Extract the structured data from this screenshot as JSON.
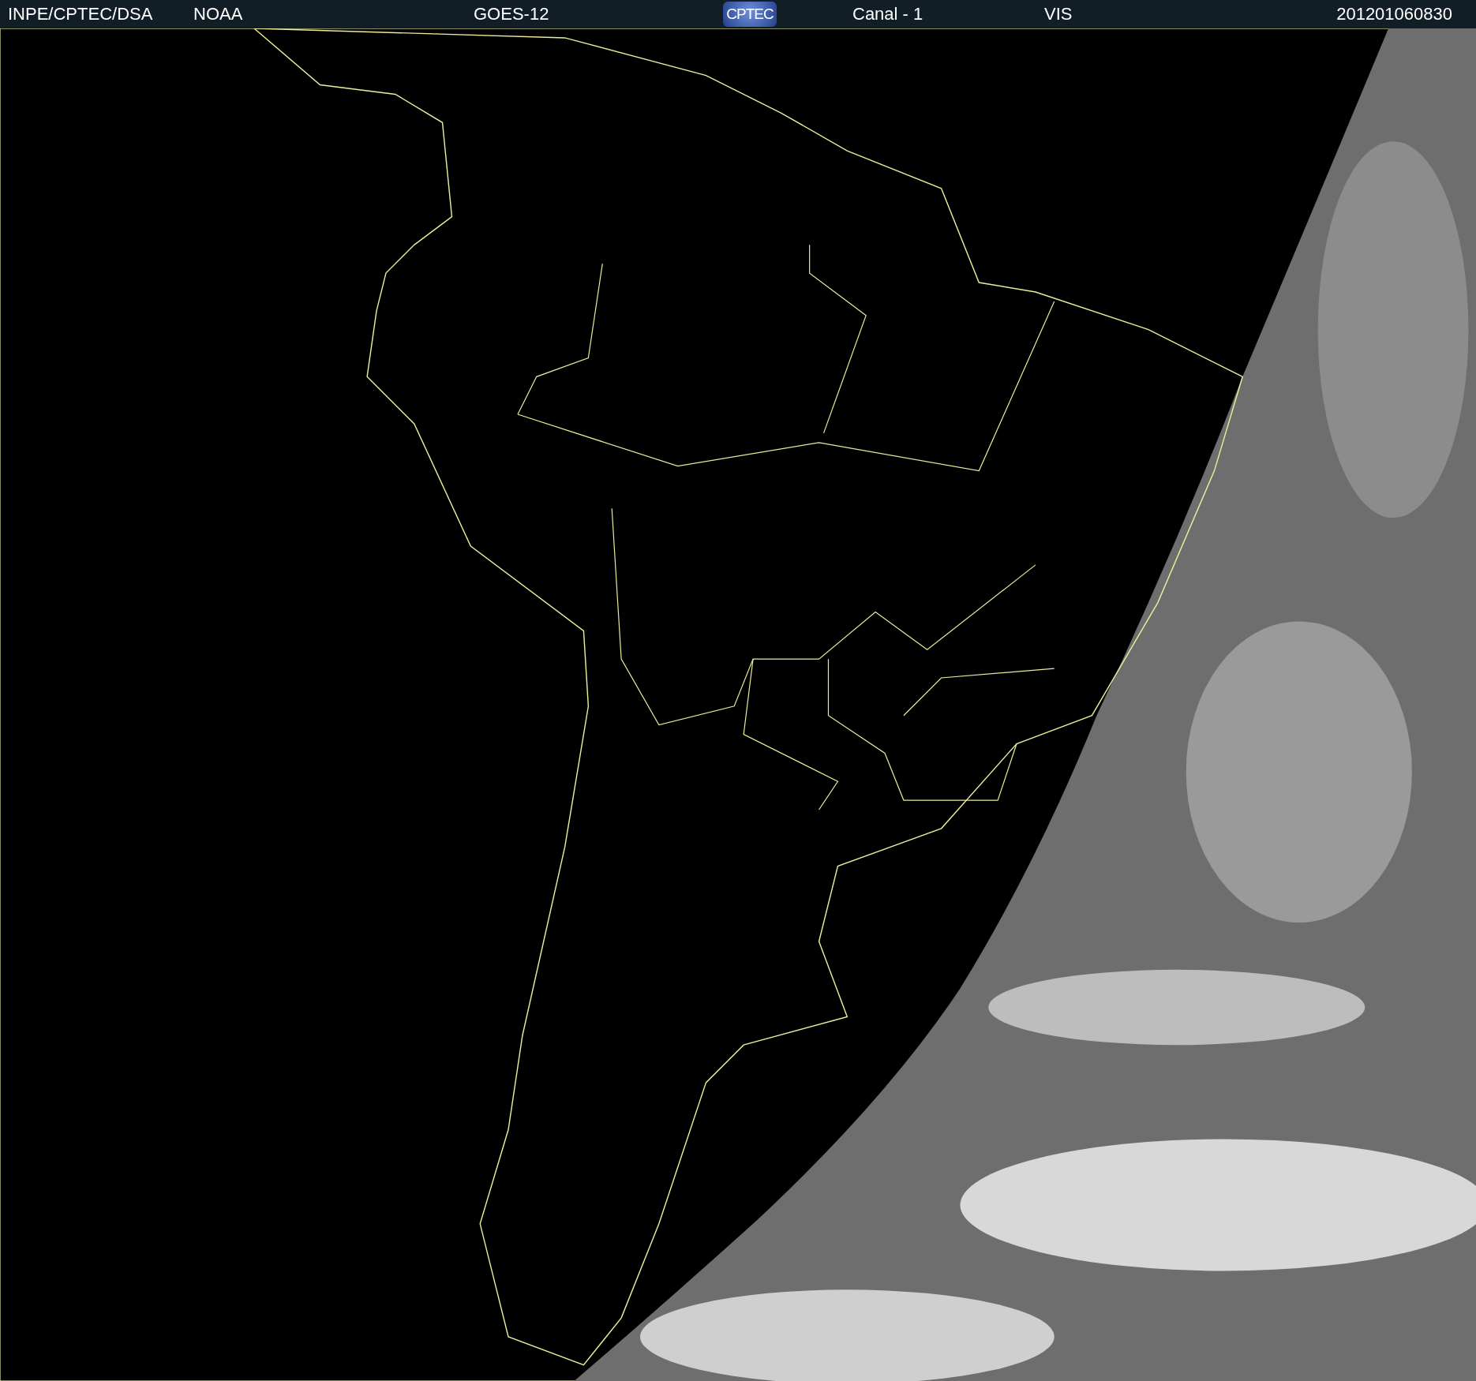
{
  "header": {
    "source": "INPE/CPTEC/DSA",
    "agency": "NOAA",
    "satellite": "GOES-12",
    "logo": "CPTEC",
    "channel": "Canal - 1",
    "band": "VIS",
    "timestamp": "201201060830"
  }
}
